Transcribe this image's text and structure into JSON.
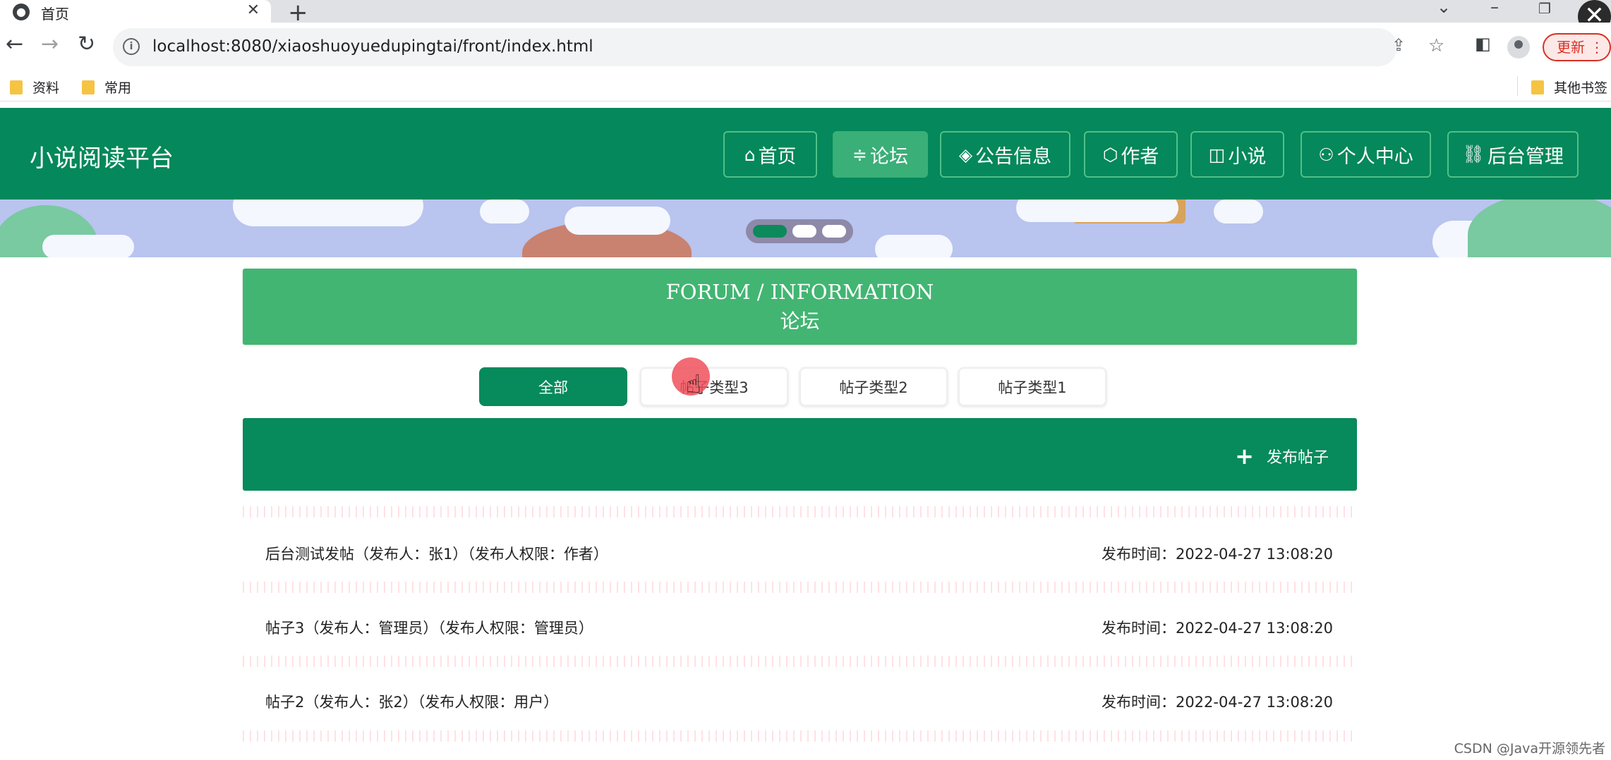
{
  "browser": {
    "tab_title": "首页",
    "url": "localhost:8080/xiaoshuoyuedupingtai/front/index.html",
    "update_label": "更新",
    "bookmarks": [
      "资料",
      "常用"
    ],
    "other_bookmarks": "其他书签"
  },
  "site": {
    "title": "小说阅读平台",
    "nav": [
      {
        "icon": "home-icon",
        "label": "首页"
      },
      {
        "icon": "sliders-icon",
        "label": "论坛"
      },
      {
        "icon": "layers-icon",
        "label": "公告信息"
      },
      {
        "icon": "cube-icon",
        "label": "作者"
      },
      {
        "icon": "book-icon",
        "label": "小说"
      },
      {
        "icon": "user-icon",
        "label": "个人中心"
      },
      {
        "icon": "link-icon",
        "label": "后台管理"
      }
    ],
    "active_nav": "论坛"
  },
  "forum": {
    "heading_en": "FORUM / INFORMATION",
    "heading_cn": "论坛",
    "filters": [
      "全部",
      "帖子类型3",
      "帖子类型2",
      "帖子类型1"
    ],
    "active_filter": "全部",
    "post_button": "发布帖子",
    "posts": [
      {
        "title": "后台测试发帖（发布人：张1）（发布人权限：作者）",
        "time": "发布时间：2022-04-27 13:08:20"
      },
      {
        "title": "帖子3（发布人：管理员）（发布人权限：管理员）",
        "time": "发布时间：2022-04-27 13:08:20"
      },
      {
        "title": "帖子2（发布人：张2）（发布人权限：用户）",
        "time": "发布时间：2022-04-27 13:08:20"
      }
    ]
  },
  "watermark": "CSDN @Java开源领先者",
  "colors": {
    "header_green": "#05885b",
    "forum_heading_green": "#42b572",
    "active_green": "#078a5c",
    "banner_blue": "#b9c4ef"
  }
}
